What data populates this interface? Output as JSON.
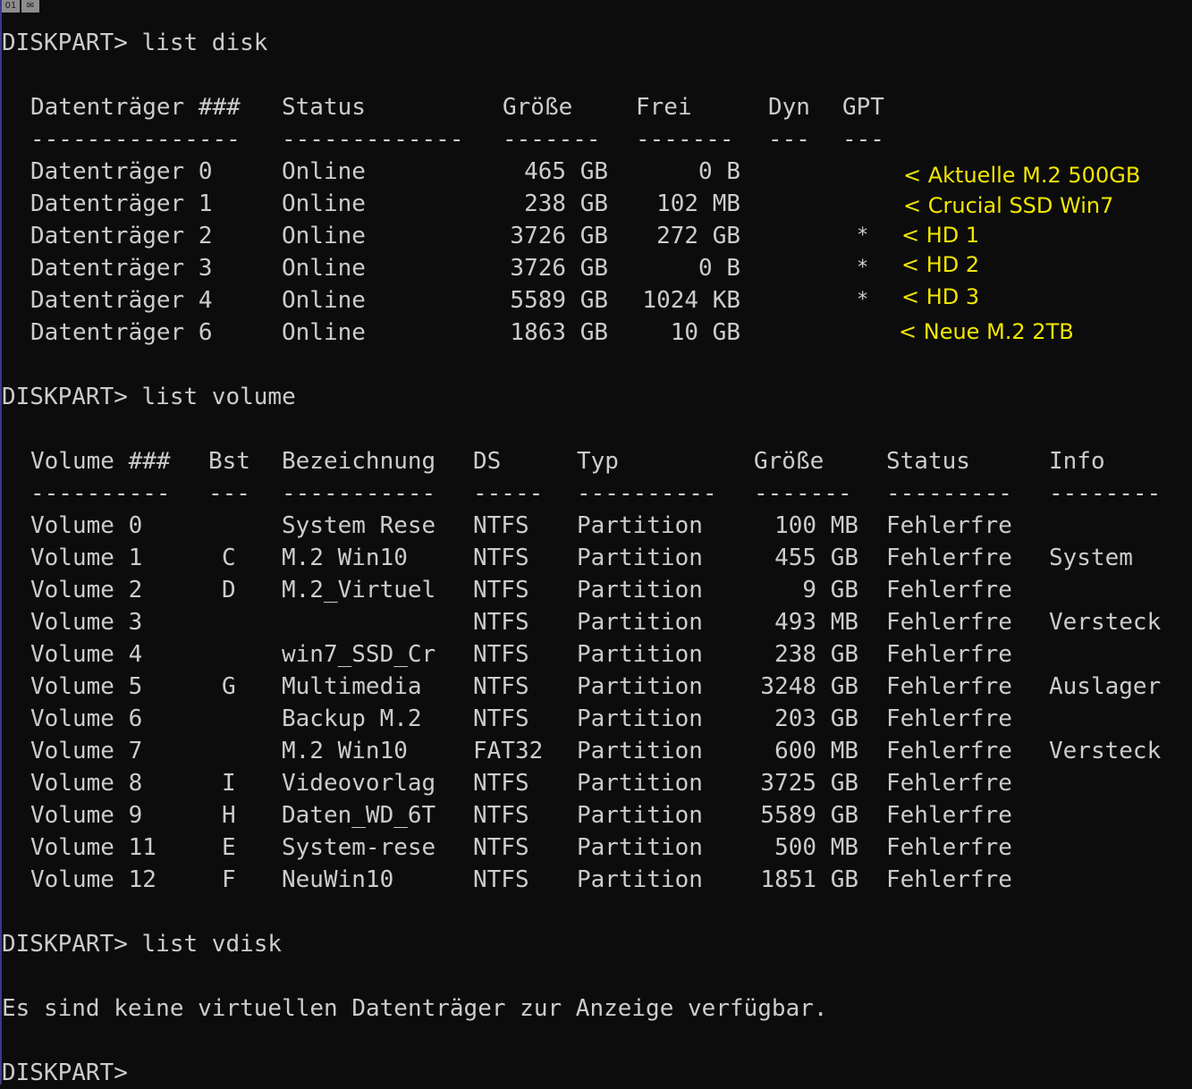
{
  "header_icons": [
    "01",
    "✉"
  ],
  "prompts": {
    "list_disk": "DISKPART> list disk",
    "list_volume": "DISKPART> list volume",
    "list_vdisk": "DISKPART> list vdisk",
    "final": "DISKPART>"
  },
  "disk_table": {
    "headers": [
      "Datenträger ###",
      "Status",
      "Größe",
      "Frei",
      "Dyn",
      "GPT"
    ],
    "separators": [
      "---------------",
      "-------------",
      "-------",
      "-------",
      "---",
      "---"
    ],
    "rows": [
      {
        "name": "Datenträger 0",
        "status": "Online",
        "size": "465 GB",
        "free": "0 B",
        "dyn": "",
        "gpt": "",
        "annotation": "< Aktuelle M.2 500GB"
      },
      {
        "name": "Datenträger 1",
        "status": "Online",
        "size": "238 GB",
        "free": "102 MB",
        "dyn": "",
        "gpt": "",
        "annotation": "< Crucial SSD Win7"
      },
      {
        "name": "Datenträger 2",
        "status": "Online",
        "size": "3726 GB",
        "free": "272 GB",
        "dyn": "",
        "gpt": "*",
        "annotation": "< HD 1"
      },
      {
        "name": "Datenträger 3",
        "status": "Online",
        "size": "3726 GB",
        "free": "0 B",
        "dyn": "",
        "gpt": "*",
        "annotation": "< HD 2"
      },
      {
        "name": "Datenträger 4",
        "status": "Online",
        "size": "5589 GB",
        "free": "1024 KB",
        "dyn": "",
        "gpt": "*",
        "annotation": "< HD 3"
      },
      {
        "name": "Datenträger 6",
        "status": "Online",
        "size": "1863 GB",
        "free": "10 GB",
        "dyn": "",
        "gpt": "",
        "annotation": "< Neue M.2 2TB"
      }
    ]
  },
  "volume_table": {
    "headers": [
      "Volume ###",
      "Bst",
      "Bezeichnung",
      "DS",
      "Typ",
      "Größe",
      "Status",
      "Info"
    ],
    "separators": [
      "----------",
      "---",
      "-----------",
      "-----",
      "----------",
      "-------",
      "---------",
      "--------"
    ],
    "rows": [
      {
        "vol": "Volume 0",
        "ltr": "",
        "label": "System Rese",
        "fs": "NTFS",
        "type": "Partition",
        "size": "100 MB",
        "status": "Fehlerfre",
        "info": ""
      },
      {
        "vol": "Volume 1",
        "ltr": "C",
        "label": "M.2 Win10",
        "fs": "NTFS",
        "type": "Partition",
        "size": "455 GB",
        "status": "Fehlerfre",
        "info": "System"
      },
      {
        "vol": "Volume 2",
        "ltr": "D",
        "label": "M.2_Virtuel",
        "fs": "NTFS",
        "type": "Partition",
        "size": "9 GB",
        "status": "Fehlerfre",
        "info": ""
      },
      {
        "vol": "Volume 3",
        "ltr": "",
        "label": "",
        "fs": "NTFS",
        "type": "Partition",
        "size": "493 MB",
        "status": "Fehlerfre",
        "info": "Versteck"
      },
      {
        "vol": "Volume 4",
        "ltr": "",
        "label": "win7_SSD_Cr",
        "fs": "NTFS",
        "type": "Partition",
        "size": "238 GB",
        "status": "Fehlerfre",
        "info": ""
      },
      {
        "vol": "Volume 5",
        "ltr": "G",
        "label": "Multimedia",
        "fs": "NTFS",
        "type": "Partition",
        "size": "3248 GB",
        "status": "Fehlerfre",
        "info": "Auslager"
      },
      {
        "vol": "Volume 6",
        "ltr": "",
        "label": "Backup M.2",
        "fs": "NTFS",
        "type": "Partition",
        "size": "203 GB",
        "status": "Fehlerfre",
        "info": ""
      },
      {
        "vol": "Volume 7",
        "ltr": "",
        "label": "M.2 Win10",
        "fs": "FAT32",
        "type": "Partition",
        "size": "600 MB",
        "status": "Fehlerfre",
        "info": "Versteck"
      },
      {
        "vol": "Volume 8",
        "ltr": "I",
        "label": "Videovorlag",
        "fs": "NTFS",
        "type": "Partition",
        "size": "3725 GB",
        "status": "Fehlerfre",
        "info": ""
      },
      {
        "vol": "Volume 9",
        "ltr": "H",
        "label": "Daten_WD_6T",
        "fs": "NTFS",
        "type": "Partition",
        "size": "5589 GB",
        "status": "Fehlerfre",
        "info": ""
      },
      {
        "vol": "Volume 11",
        "ltr": "E",
        "label": "System-rese",
        "fs": "NTFS",
        "type": "Partition",
        "size": "500 MB",
        "status": "Fehlerfre",
        "info": ""
      },
      {
        "vol": "Volume 12",
        "ltr": "F",
        "label": "NeuWin10",
        "fs": "NTFS",
        "type": "Partition",
        "size": "1851 GB",
        "status": "Fehlerfre",
        "info": ""
      }
    ]
  },
  "vdisk_message": "Es sind keine virtuellen Datenträger zur Anzeige verfügbar.",
  "colors": {
    "background": "#0c0c0c",
    "text": "#cccccc",
    "annotation": "#f2e600"
  }
}
